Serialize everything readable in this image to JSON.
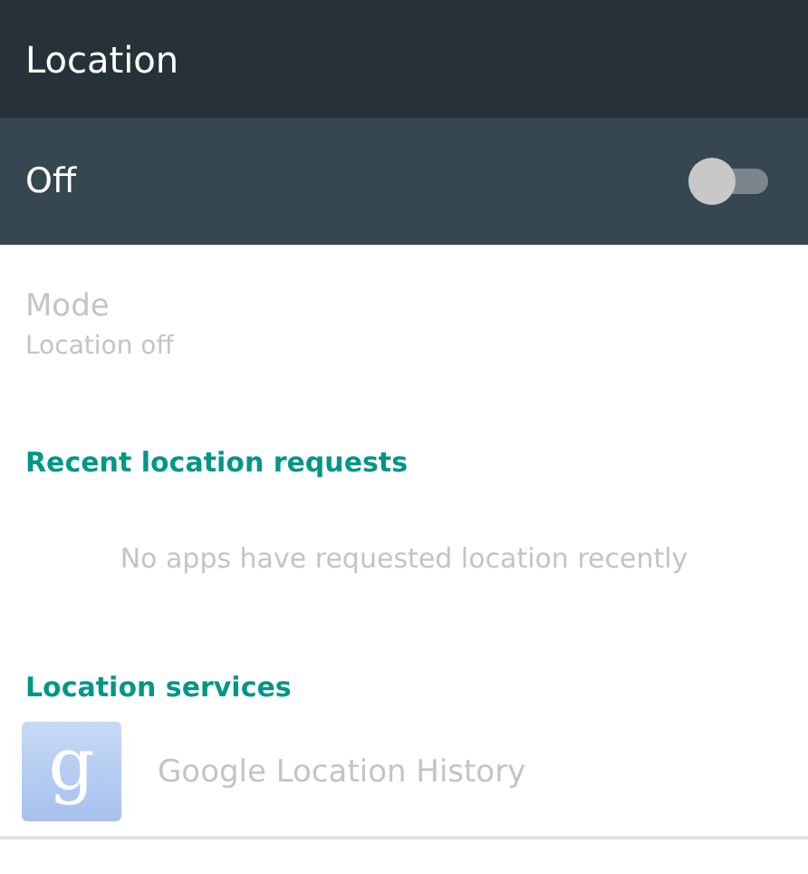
{
  "app_bar": {
    "title": "Location"
  },
  "master_switch": {
    "label": "Off",
    "on": false
  },
  "mode": {
    "title": "Mode",
    "summary": "Location off",
    "disabled": true
  },
  "recent_requests": {
    "heading": "Recent location requests",
    "empty_message": "No apps have requested location recently"
  },
  "location_services": {
    "heading": "Location services",
    "items": [
      {
        "icon_glyph": "g",
        "label": "Google Location History",
        "disabled": true
      }
    ]
  }
}
